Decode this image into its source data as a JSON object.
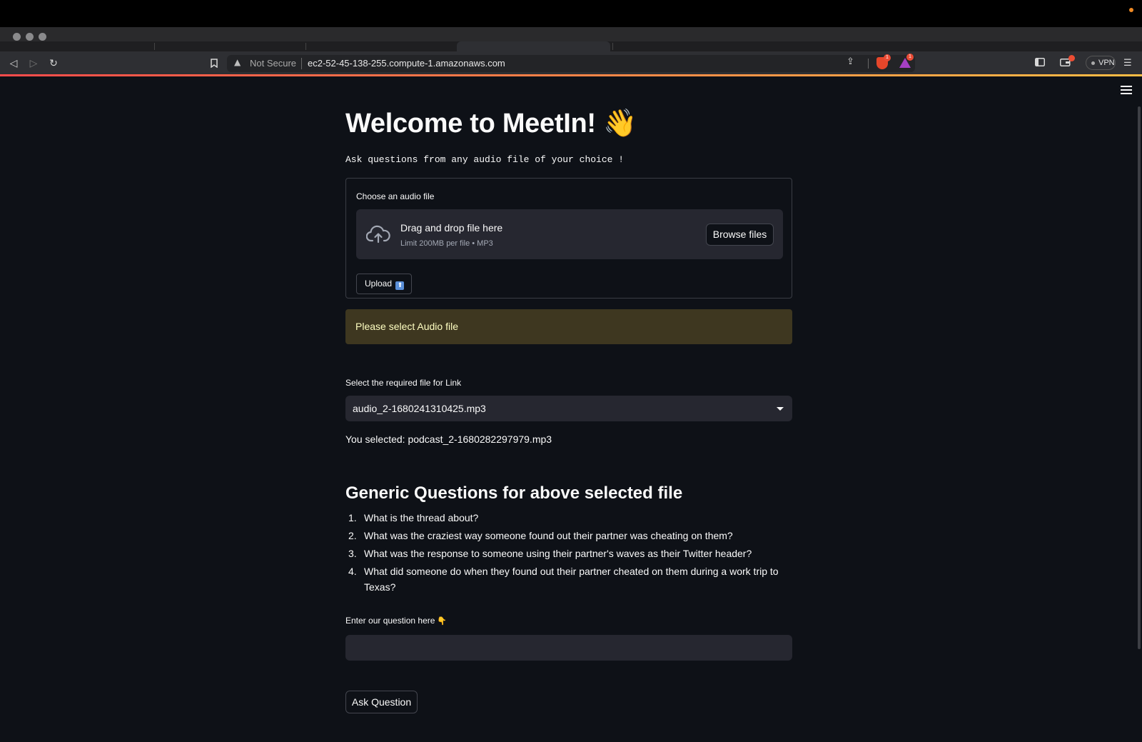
{
  "browser": {
    "security_label": "Not Secure",
    "url": "ec2-52-45-138-255.compute-1.amazonaws.com",
    "vpn_label": "VPN",
    "brave_badge": "1",
    "rewards_badge": "1"
  },
  "app": {
    "title": "Welcome to MeetIn! 👋",
    "subtitle": "Ask questions from any audio file of your choice !",
    "uploader": {
      "label": "Choose an audio file",
      "drop_title": "Drag and drop file here",
      "drop_hint": "Limit 200MB per file • MP3",
      "browse_label": "Browse files",
      "upload_label": "Upload",
      "upload_emoji": "⬆"
    },
    "warning": "Please select Audio file",
    "file_select": {
      "label": "Select the required file for Link",
      "value": "audio_2-1680241310425.mp3"
    },
    "selected_text": "You selected: podcast_2-1680282297979.mp3",
    "questions_heading": "Generic Questions for above selected file",
    "questions": [
      {
        "num": "1.",
        "text": "What is the thread about?"
      },
      {
        "num": "2.",
        "text": "What was the craziest way someone found out their partner was cheating on them?"
      },
      {
        "num": "3.",
        "text": "What was the response to someone using their partner's waves as their Twitter header?"
      },
      {
        "num": "4.",
        "text": "What did someone do when they found out their partner cheated on them during a work trip to Texas?"
      }
    ],
    "question_input": {
      "label": "Enter our question here",
      "label_emoji": "👇",
      "value": "",
      "placeholder": ""
    },
    "ask_label": "Ask Question"
  },
  "colors": {
    "app_background": "#0e1117",
    "widget_background": "#262730",
    "warning_background": "#3e3720",
    "warning_text": "#ffffc2",
    "accent_gradient_start": "#ff4b4b",
    "accent_gradient_end": "#ffbd45"
  }
}
